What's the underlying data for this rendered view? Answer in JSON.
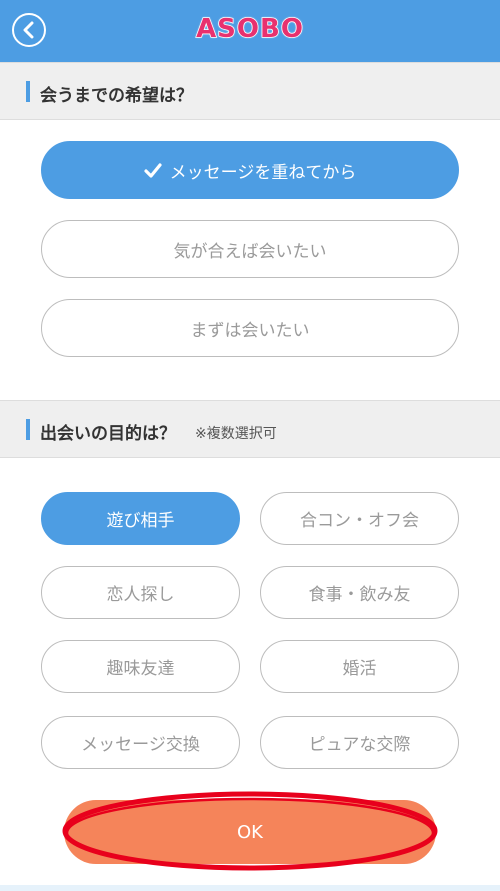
{
  "header": {
    "logo": "ASOBO",
    "accent": "#4d9de3",
    "logo_color": "#e8316f",
    "back_icon": "chevron-left-icon"
  },
  "section1": {
    "title": "会うまでの希望は？",
    "options": [
      {
        "label": "メッセージを重ねてから",
        "selected": true
      },
      {
        "label": "気が合えば会いたい",
        "selected": false
      },
      {
        "label": "まずは会いたい",
        "selected": false
      }
    ]
  },
  "section2": {
    "title": "出会いの目的は？",
    "note": "※複数選択可",
    "options": [
      {
        "label": "遊び相手",
        "selected": true
      },
      {
        "label": "合コン・オフ会",
        "selected": false
      },
      {
        "label": "恋人探し",
        "selected": false
      },
      {
        "label": "食事・飲み友",
        "selected": false
      },
      {
        "label": "趣味友達",
        "selected": false
      },
      {
        "label": "婚活",
        "selected": false
      },
      {
        "label": "メッセージ交換",
        "selected": false
      },
      {
        "label": "ピュアな交際",
        "selected": false
      }
    ]
  },
  "ok_button": {
    "label": "OK",
    "color": "#f5845a",
    "highlight_color": "#e8001c"
  }
}
